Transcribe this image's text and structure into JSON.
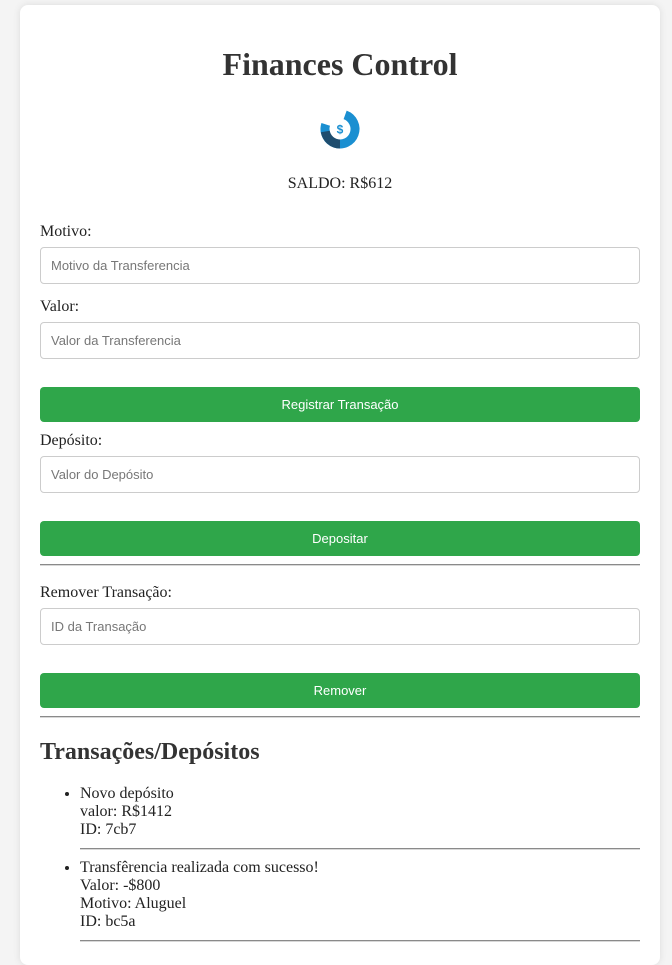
{
  "app": {
    "title": "Finances Control",
    "logo_icon": "dollar-refresh-icon",
    "colors": {
      "primary_button": "#2fa64a",
      "logo_blue": "#1a8fd1",
      "logo_dark": "#1f4d6e"
    }
  },
  "balance": {
    "label": "SALDO:",
    "value": "R$612"
  },
  "transfer_form": {
    "reason_label": "Motivo:",
    "reason_placeholder": "Motivo da Transferencia",
    "value_label": "Valor:",
    "value_placeholder": "Valor da Transferencia",
    "submit_label": "Registrar Transação"
  },
  "deposit_form": {
    "label": "Depósito:",
    "placeholder": "Valor do Depósito",
    "submit_label": "Depositar"
  },
  "remove_form": {
    "label": "Remover Transação:",
    "placeholder": "ID da Transação",
    "submit_label": "Remover"
  },
  "history": {
    "title": "Transações/Depósitos",
    "items": [
      {
        "lines": [
          "Novo depósito",
          "valor: R$1412",
          "ID: 7cb7"
        ]
      },
      {
        "lines": [
          "Transfêrencia realizada com sucesso!",
          "Valor: -$800",
          "Motivo: Aluguel",
          "ID: bc5a"
        ]
      }
    ]
  }
}
